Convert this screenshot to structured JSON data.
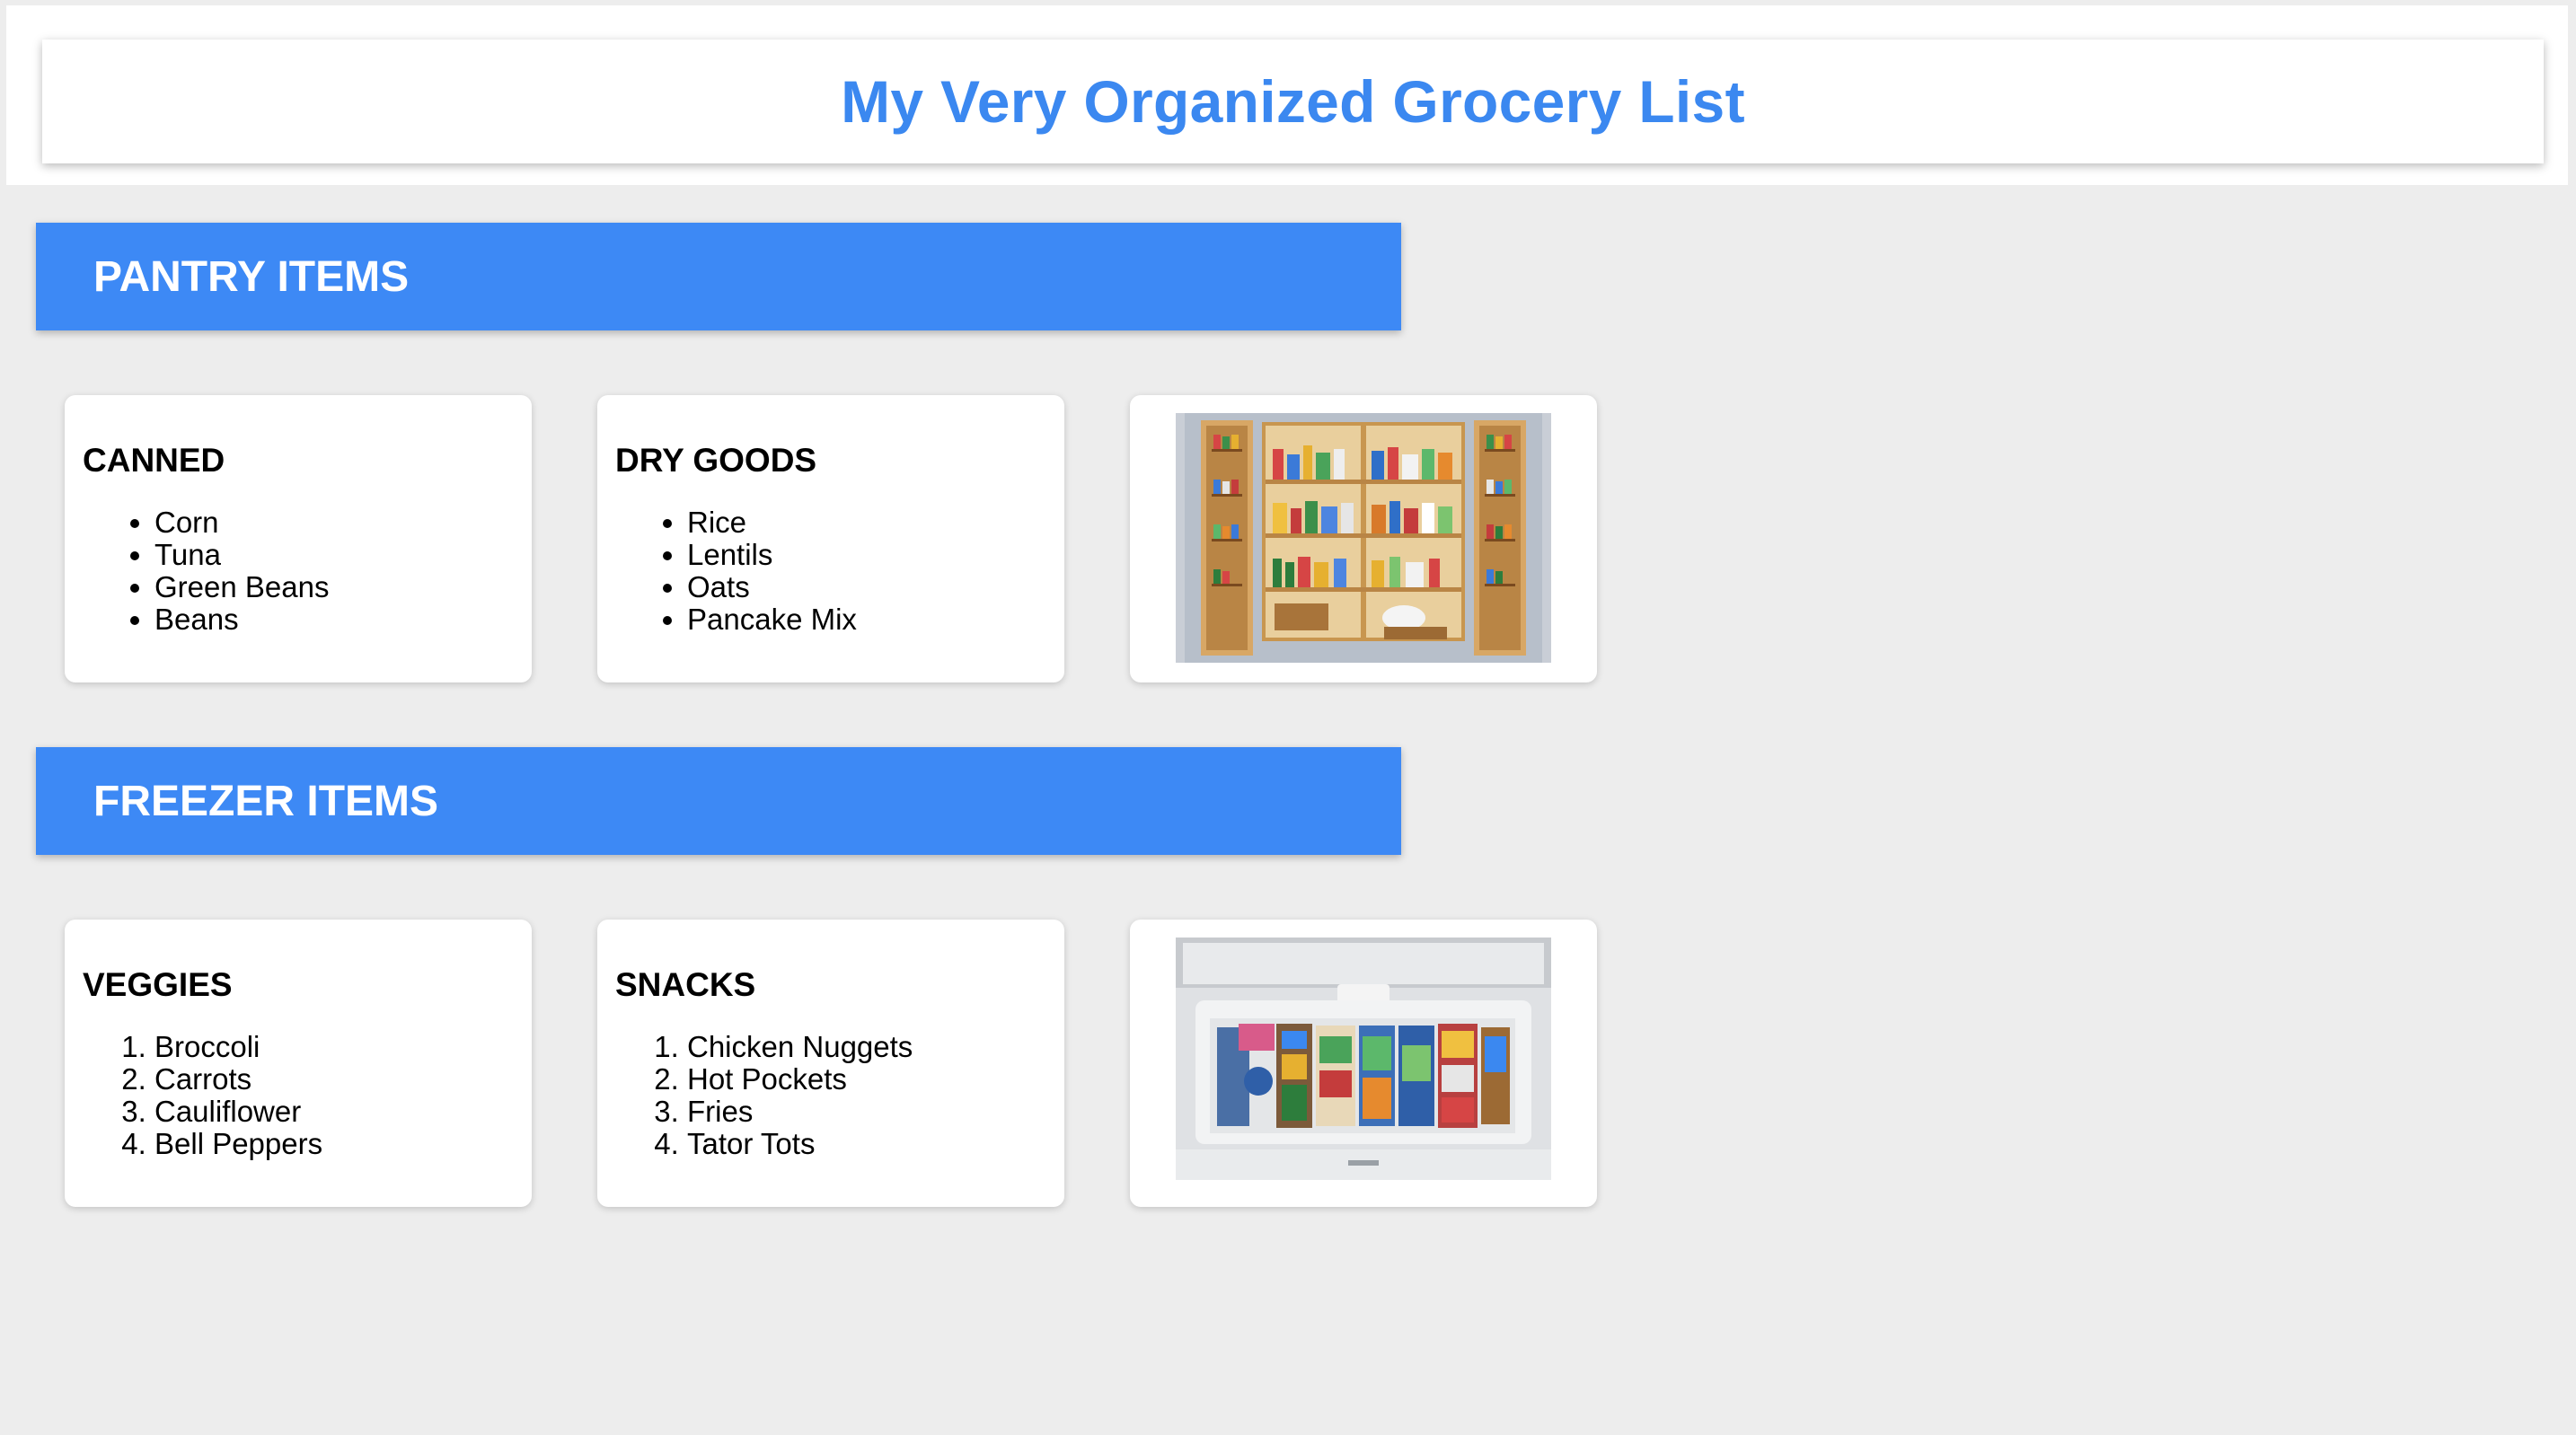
{
  "header": {
    "title": "My Very Organized Grocery List"
  },
  "pantry": {
    "title": "PANTRY ITEMS",
    "canned": {
      "title": "CANNED",
      "items": [
        "Corn",
        "Tuna",
        "Green Beans",
        "Beans"
      ]
    },
    "dry_goods": {
      "title": "DRY GOODS",
      "items": [
        "Rice",
        "Lentils",
        "Oats",
        "Pancake Mix"
      ]
    },
    "image": {
      "description_icon": "pantry-photo"
    }
  },
  "freezer": {
    "title": "FREEZER ITEMS",
    "veggies": {
      "title": "VEGGIES",
      "items": [
        "Broccoli",
        "Carrots",
        "Cauliflower",
        "Bell Peppers"
      ]
    },
    "snacks": {
      "title": "SNACKS",
      "items": [
        "Chicken Nuggets",
        "Hot Pockets",
        "Fries",
        "Tator Tots"
      ]
    },
    "image": {
      "description_icon": "freezer-photo"
    }
  },
  "colors": {
    "title": "#3b88f0",
    "banner": "#3d89f5",
    "background": "#ededed",
    "card": "#ffffff"
  }
}
